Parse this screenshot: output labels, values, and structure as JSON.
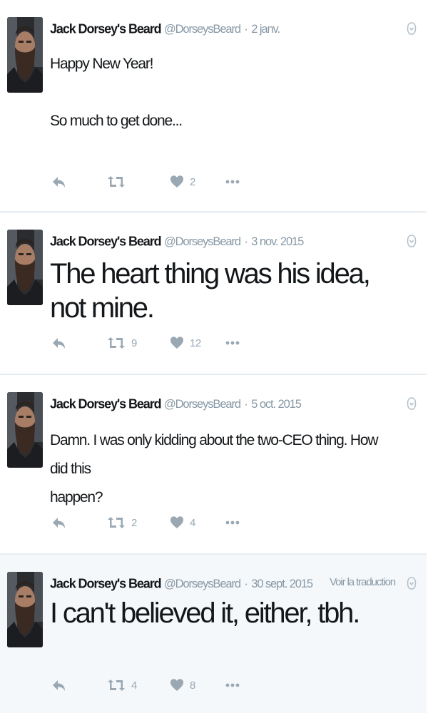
{
  "tweets": [
    {
      "name": "Jack Dorsey's Beard",
      "handle": "@DorseysBeard",
      "date": "2 janv.",
      "lines": [
        "Happy New Year!",
        "",
        "So much to get done..."
      ],
      "retweets": "",
      "likes": "2",
      "translate": ""
    },
    {
      "name": "Jack Dorsey's Beard",
      "handle": "@DorseysBeard",
      "date": "3 nov. 2015",
      "lines": [
        "The heart thing was his idea, not mine."
      ],
      "retweets": "9",
      "likes": "12",
      "translate": ""
    },
    {
      "name": "Jack Dorsey's Beard",
      "handle": "@DorseysBeard",
      "date": "5 oct. 2015",
      "lines": [
        "Damn. I was only kidding about the two-CEO thing. How did this",
        "happen?"
      ],
      "retweets": "2",
      "likes": "4",
      "translate": ""
    },
    {
      "name": "Jack Dorsey's Beard",
      "handle": "@DorseysBeard",
      "date": "30 sept. 2015",
      "lines": [
        "I can't believed it, either, tbh."
      ],
      "retweets": "4",
      "likes": "8",
      "translate": "Voir la traduction"
    }
  ],
  "icons": {
    "reply": "reply-icon",
    "retweet": "retweet-icon",
    "like": "heart-icon",
    "more": "more-dots-icon",
    "caret": "caret-down-icon"
  },
  "colors": {
    "text": "#14171a",
    "muted": "#8899a6",
    "action": "#9aa8b4",
    "divider": "#e6ecf0",
    "shaded_bg": "#f5f8fa"
  },
  "separator": "·"
}
